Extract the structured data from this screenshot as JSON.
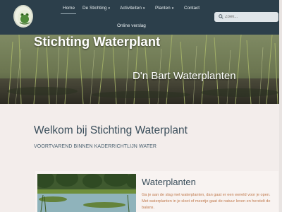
{
  "colors": {
    "nav_bg": "#2c3f4b",
    "heading": "#3a4e5b",
    "body_text_orange": "#c07a4d",
    "page_bg": "#f3edeb"
  },
  "logo": {
    "icon": "frog-logo-icon"
  },
  "nav": {
    "home": "Home",
    "stichting": "De Stichting",
    "activiteiten": "Activiteiten",
    "planten": "Planten",
    "contact": "Contact",
    "online_verslag": "Online verslag"
  },
  "search": {
    "placeholder": "Zoek..."
  },
  "hero": {
    "title": "Stichting Waterplant",
    "subtitle": "D'n Bart Waterplanten"
  },
  "intro": {
    "heading": "Welkom bij Stichting Waterplant",
    "tagline": "VOORTVAREND BINNEN KADERRICHTLIJN WATER"
  },
  "card": {
    "title": "Waterplanten",
    "text": "Ga je aan de slag met waterplanten, dan gaat er een wereld voor je open. Met waterplanten in je sloot of meertje gaat de natuur leven en herstelt de balans."
  }
}
